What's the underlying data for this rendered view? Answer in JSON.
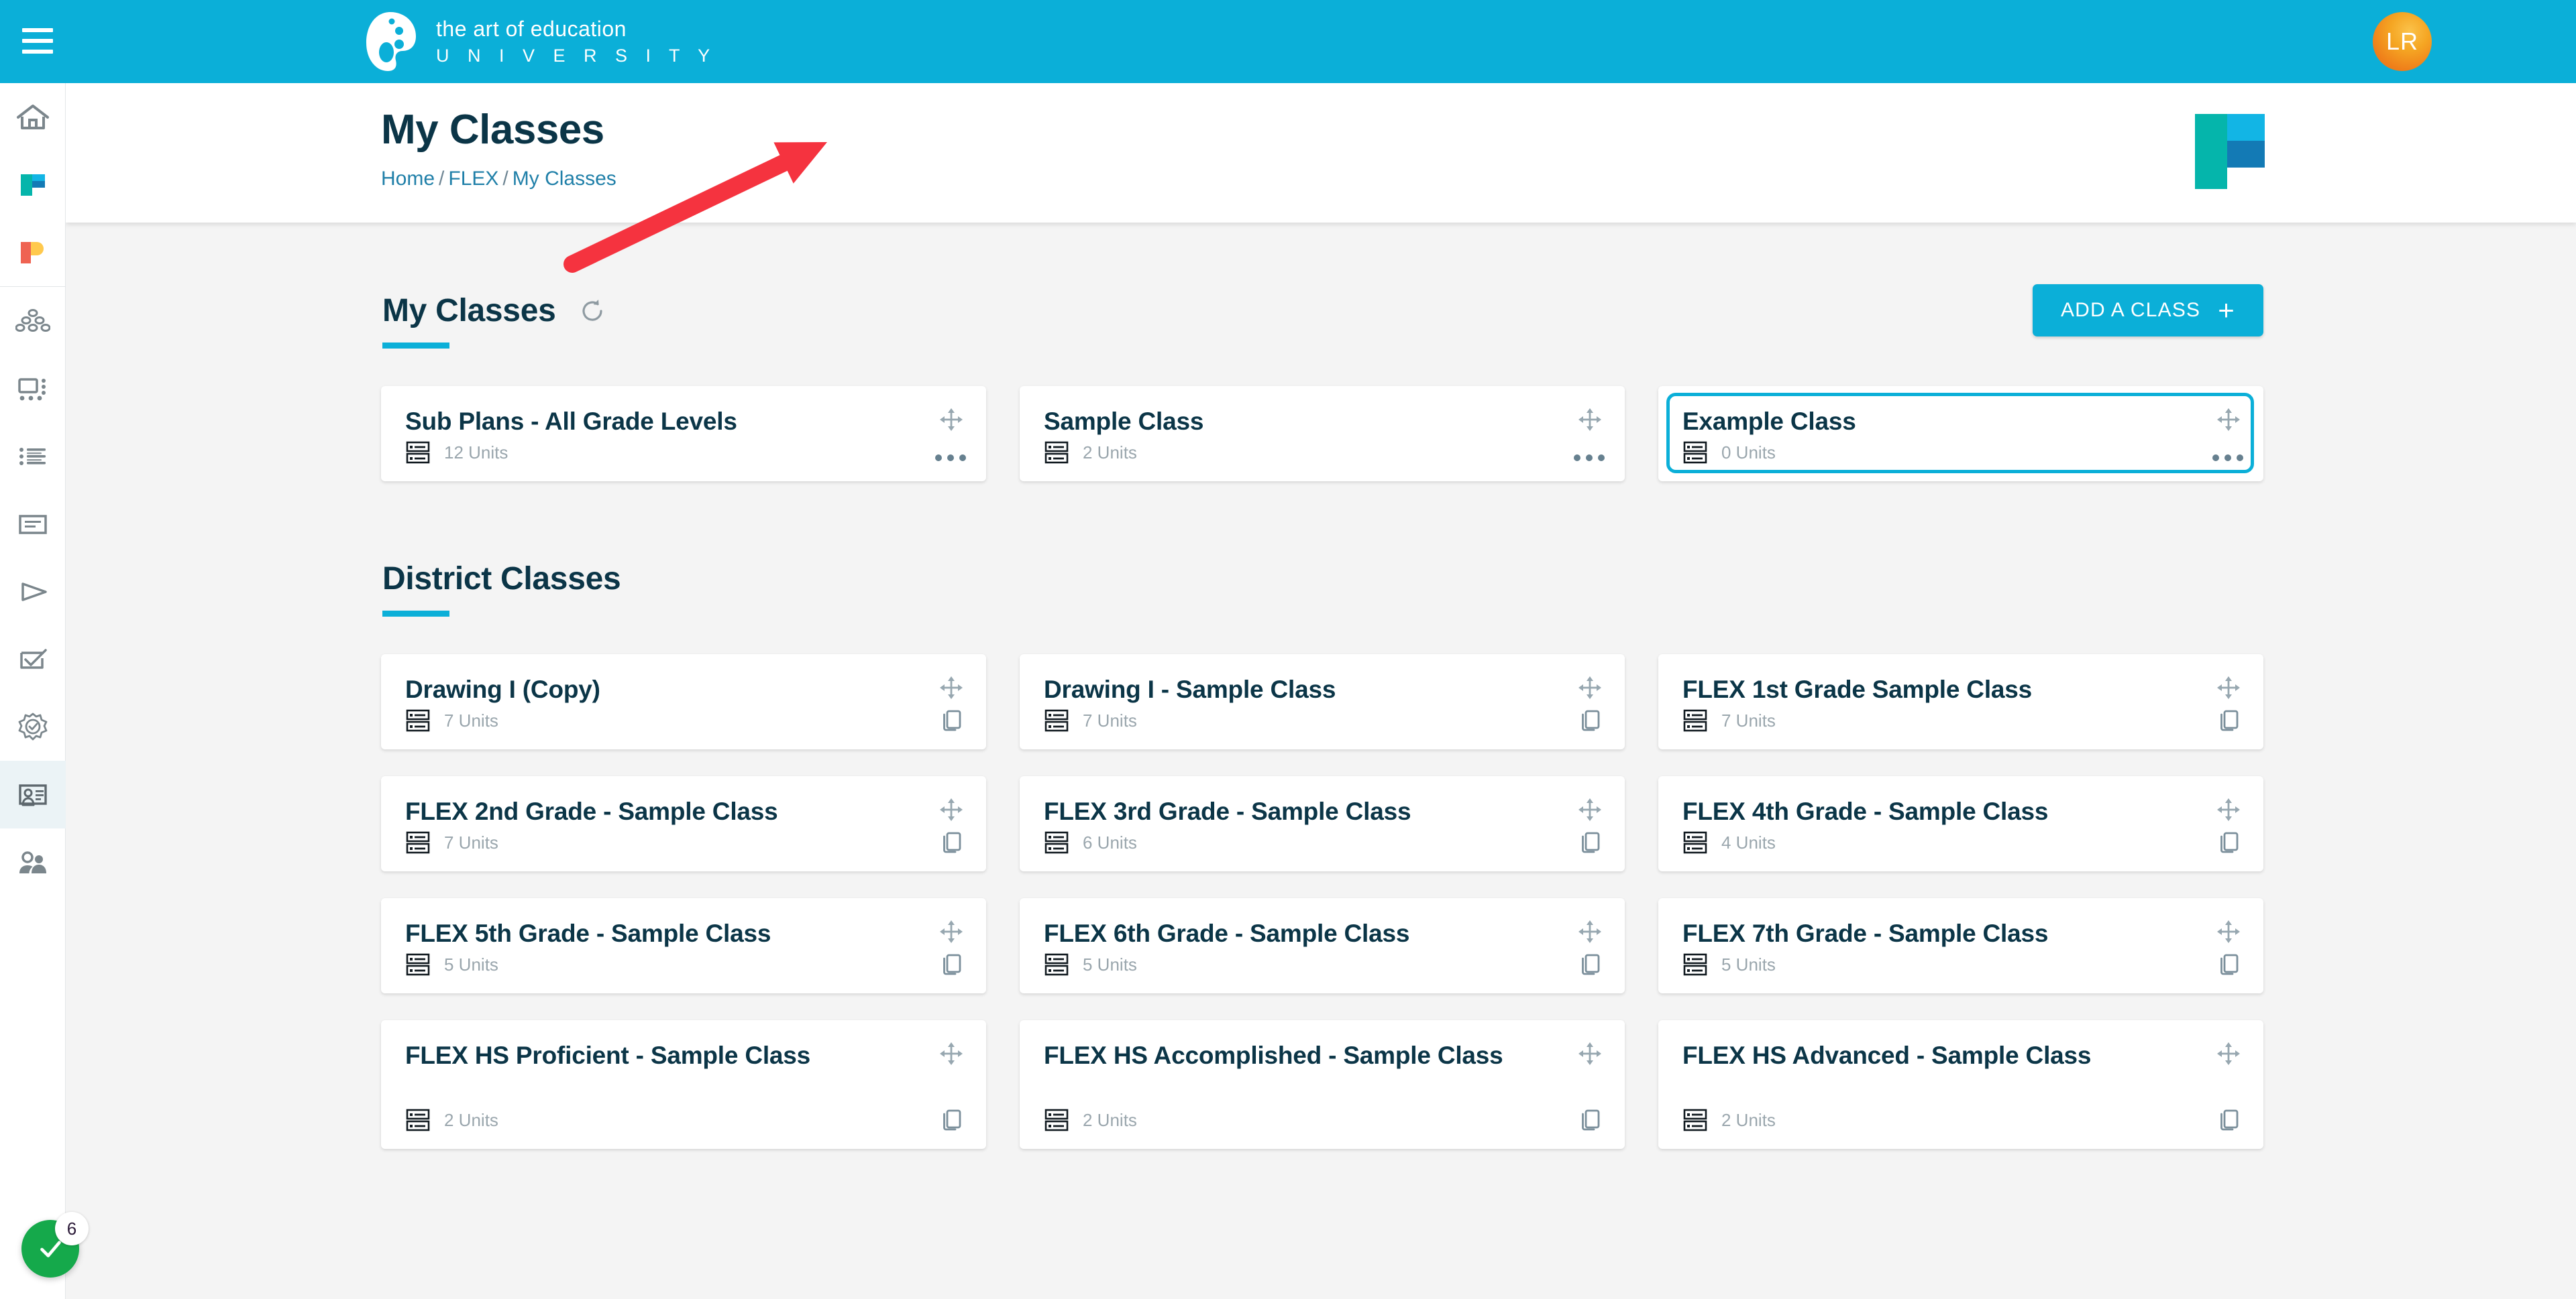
{
  "topbar": {
    "menu_icon": "hamburger-icon",
    "brand_line1": "the art of education",
    "brand_line2": "U N I V E R S I T Y",
    "avatar_initials": "LR"
  },
  "sidebar": {
    "items": [
      {
        "name": "home",
        "icon": "home-icon",
        "active": false
      },
      {
        "name": "flex",
        "icon": "flex-logo-icon",
        "active": false
      },
      {
        "name": "pro",
        "icon": "pro-logo-icon",
        "active": false
      },
      {
        "name": "community",
        "icon": "community-icon",
        "active": false
      },
      {
        "name": "dashboard",
        "icon": "dashboard-icon",
        "active": false
      },
      {
        "name": "lists",
        "icon": "list-icon",
        "active": false
      },
      {
        "name": "articles",
        "icon": "article-icon",
        "active": false
      },
      {
        "name": "videos",
        "icon": "play-icon",
        "active": false
      },
      {
        "name": "assessments",
        "icon": "checklist-icon",
        "active": false
      },
      {
        "name": "standards",
        "icon": "badge-icon",
        "active": false
      },
      {
        "name": "classes",
        "icon": "id-card-icon",
        "active": true
      },
      {
        "name": "students",
        "icon": "people-icon",
        "active": false
      }
    ]
  },
  "page": {
    "title": "My Classes",
    "breadcrumb": [
      {
        "label": "Home",
        "link": true
      },
      {
        "label": "FLEX",
        "link": true
      },
      {
        "label": "My Classes",
        "link": true
      }
    ],
    "flex_logo": "flex-logo-mark"
  },
  "my_classes": {
    "heading": "My Classes",
    "refresh_icon": "refresh-icon",
    "add_button_label": "ADD A CLASS",
    "add_button_plus": "+",
    "cards": [
      {
        "title": "Sub Plans - All Grade Levels",
        "units": "12 Units",
        "menu": "more-options",
        "highlighted": false
      },
      {
        "title": "Sample Class",
        "units": "2 Units",
        "menu": "more-options",
        "highlighted": false
      },
      {
        "title": "Example Class",
        "units": "0 Units",
        "menu": "more-options",
        "highlighted": true
      }
    ]
  },
  "district_classes": {
    "heading": "District Classes",
    "cards": [
      {
        "title": "Drawing I (Copy)",
        "units": "7 Units"
      },
      {
        "title": "Drawing I - Sample Class",
        "units": "7 Units"
      },
      {
        "title": "FLEX 1st Grade Sample Class",
        "units": "7 Units"
      },
      {
        "title": "FLEX 2nd Grade - Sample Class",
        "units": "7 Units"
      },
      {
        "title": "FLEX 3rd Grade - Sample Class",
        "units": "6 Units"
      },
      {
        "title": "FLEX 4th Grade - Sample Class",
        "units": "4 Units"
      },
      {
        "title": "FLEX 5th Grade - Sample Class",
        "units": "5 Units"
      },
      {
        "title": "FLEX 6th Grade - Sample Class",
        "units": "5 Units"
      },
      {
        "title": "FLEX 7th Grade - Sample Class",
        "units": "5 Units"
      },
      {
        "title": "FLEX HS Proficient - Sample Class",
        "units": "2 Units"
      },
      {
        "title": "FLEX HS Accomplished - Sample Class",
        "units": "2 Units"
      },
      {
        "title": "FLEX HS Advanced - Sample Class",
        "units": "2 Units"
      }
    ]
  },
  "fab": {
    "icon": "checkmark-icon",
    "badge_count": "6"
  },
  "annotation": {
    "type": "arrow",
    "color": "#F5333F",
    "points_to": "Example Class"
  },
  "colors": {
    "brand_cyan": "#0BAFD8",
    "title_navy": "#0b3547",
    "link_blue": "#1f7fa8",
    "muted_gray": "#9aa6ad",
    "page_bg": "#f4f4f4",
    "annotation_red": "#F5333F",
    "fab_green": "#15a94b"
  }
}
